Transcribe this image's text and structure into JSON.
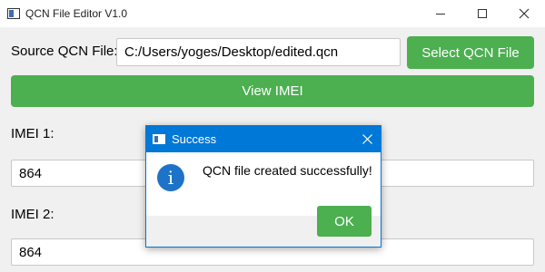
{
  "window": {
    "title": "QCN File Editor V1.0"
  },
  "source": {
    "label": "Source QCN File:",
    "value": "C:/Users/yoges/Desktop/edited.qcn",
    "select_button": "Select QCN File"
  },
  "view_imei_button": "View IMEI",
  "imei1": {
    "label": "IMEI 1:",
    "value": "864"
  },
  "imei2": {
    "label": "IMEI 2:",
    "value": "864"
  },
  "dialog": {
    "title": "Success",
    "message": "QCN file created successfully!",
    "ok_button": "OK",
    "icon": "info-icon"
  },
  "colors": {
    "accent_green": "#4caf50",
    "dialog_blue": "#0078d7"
  }
}
